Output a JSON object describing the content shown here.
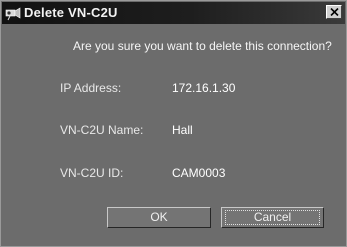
{
  "window": {
    "title": "Delete VN-C2U",
    "icon": "network-camera-icon",
    "close_symbol": "×"
  },
  "dialog": {
    "prompt": "Are you sure you want to delete this connection?",
    "fields": [
      {
        "label": "IP Address:",
        "value": "172.16.1.30"
      },
      {
        "label": "VN-C2U Name:",
        "value": "Hall"
      },
      {
        "label": "VN-C2U ID:",
        "value": "CAM0003"
      }
    ]
  },
  "buttons": {
    "ok": "OK",
    "cancel": "Cancel"
  }
}
